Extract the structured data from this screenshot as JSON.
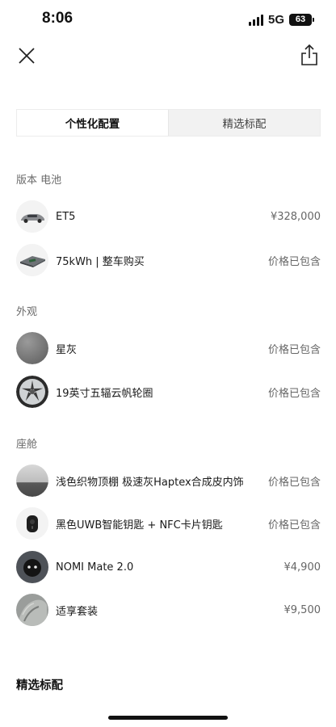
{
  "status": {
    "time": "8:06",
    "network": "5G",
    "battery": "63"
  },
  "tabs": [
    {
      "label": "个性化配置",
      "active": true
    },
    {
      "label": "精选标配",
      "active": false
    }
  ],
  "sections": {
    "version": {
      "title": "版本 电池",
      "items": [
        {
          "label": "ET5",
          "value": "¥328,000",
          "icon": "car-icon"
        },
        {
          "label": "75kWh | 整车购买",
          "value": "价格已包含",
          "icon": "battery-pack-icon"
        }
      ]
    },
    "exterior": {
      "title": "外观",
      "items": [
        {
          "label": "星灰",
          "value": "价格已包含",
          "icon": "paint-swatch-icon",
          "color": "#7d7d7d"
        },
        {
          "label": "19英寸五辐云帆轮圈",
          "value": "价格已包含",
          "icon": "wheel-icon"
        }
      ]
    },
    "cabin": {
      "title": "座舱",
      "items": [
        {
          "label": "浅色织物顶棚 极速灰Haptex合成皮内饰",
          "value": "价格已包含",
          "icon": "interior-swatch-icon"
        },
        {
          "label": "黑色UWB智能钥匙 + NFC卡片钥匙",
          "value": "价格已包含",
          "icon": "key-icon"
        },
        {
          "label": "NOMI Mate 2.0",
          "value": "¥4,900",
          "icon": "nomi-icon"
        },
        {
          "label": "适享套装",
          "value": "¥9,500",
          "icon": "seat-package-icon"
        }
      ]
    }
  },
  "bottom": {
    "title": "精选标配"
  }
}
